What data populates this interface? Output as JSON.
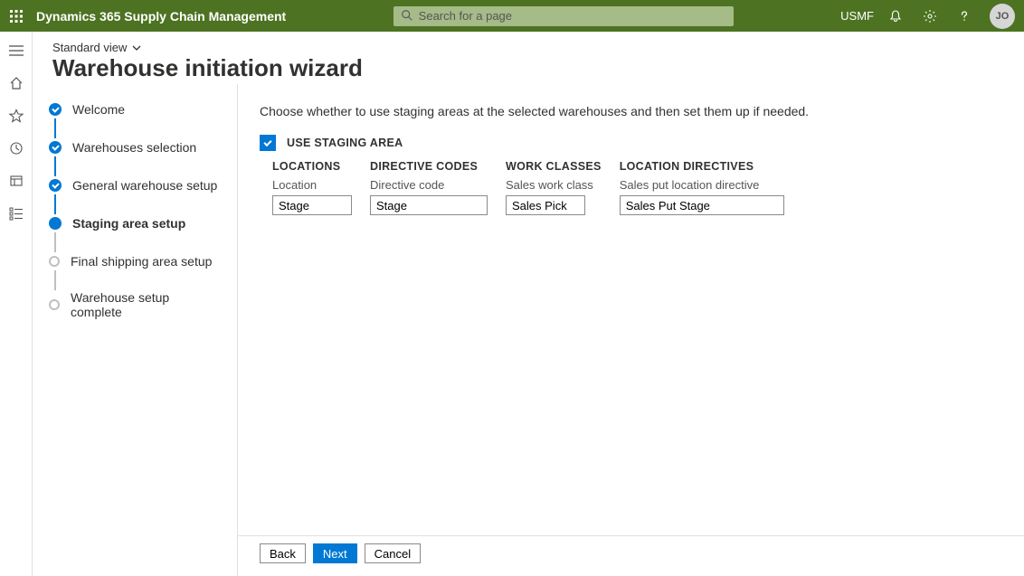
{
  "header": {
    "app_title": "Dynamics 365 Supply Chain Management",
    "search_placeholder": "Search for a page",
    "company": "USMF",
    "avatar_initials": "JO"
  },
  "page": {
    "view_label": "Standard view",
    "title": "Warehouse initiation wizard"
  },
  "steps": [
    {
      "label": "Welcome",
      "state": "done"
    },
    {
      "label": "Warehouses selection",
      "state": "done"
    },
    {
      "label": "General warehouse setup",
      "state": "done"
    },
    {
      "label": "Staging area setup",
      "state": "current"
    },
    {
      "label": "Final shipping area setup",
      "state": "todo"
    },
    {
      "label": "Warehouse setup complete",
      "state": "todo"
    }
  ],
  "main": {
    "instruction": "Choose whether to use staging areas at the selected warehouses and then set them up if needed.",
    "checkbox_label": "USE STAGING AREA",
    "columns": {
      "locations": {
        "header": "LOCATIONS",
        "field_label": "Location",
        "value": "Stage"
      },
      "directive_codes": {
        "header": "DIRECTIVE CODES",
        "field_label": "Directive code",
        "value": "Stage"
      },
      "work_classes": {
        "header": "WORK CLASSES",
        "field_label": "Sales work class",
        "value": "Sales Pick"
      },
      "location_directives": {
        "header": "LOCATION DIRECTIVES",
        "field_label": "Sales put location directive",
        "value": "Sales Put Stage"
      }
    }
  },
  "buttons": {
    "back": "Back",
    "next": "Next",
    "cancel": "Cancel"
  }
}
